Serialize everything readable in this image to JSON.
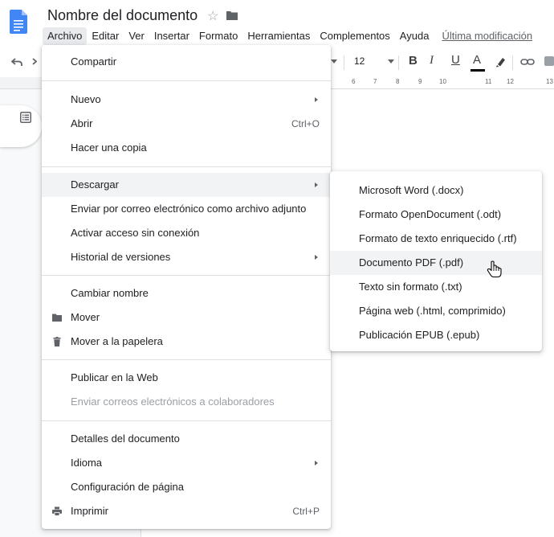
{
  "header": {
    "title": "Nombre del documento",
    "menus": [
      "Archivo",
      "Editar",
      "Ver",
      "Insertar",
      "Formato",
      "Herramientas",
      "Complementos",
      "Ayuda"
    ],
    "last_edit": "Última modificación"
  },
  "toolbar": {
    "font_size": "12",
    "bold": "B",
    "italic": "I",
    "underline": "U",
    "text_color": "A"
  },
  "ruler": [
    "6",
    "7",
    "8",
    "9",
    "10",
    "11",
    "12",
    "13"
  ],
  "file_menu": {
    "share": "Compartir",
    "new": "Nuevo",
    "open": "Abrir",
    "open_shortcut": "Ctrl+O",
    "copy": "Hacer una copia",
    "download": "Descargar",
    "email_attachment": "Enviar por correo electrónico como archivo adjunto",
    "offline": "Activar acceso sin conexión",
    "version_history": "Historial de versiones",
    "rename": "Cambiar nombre",
    "move": "Mover",
    "trash": "Mover a la papelera",
    "publish": "Publicar en la Web",
    "email_collaborators": "Enviar correos electrónicos a colaboradores",
    "details": "Detalles del documento",
    "language": "Idioma",
    "page_setup": "Configuración de página",
    "print": "Imprimir",
    "print_shortcut": "Ctrl+P"
  },
  "download_menu": {
    "items": [
      "Microsoft Word (.docx)",
      "Formato OpenDocument (.odt)",
      "Formato de texto enriquecido (.rtf)",
      "Documento PDF (.pdf)",
      "Texto sin formato (.txt)",
      "Página web (.html, comprimido)",
      "Publicación EPUB (.epub)"
    ],
    "hovered": "Documento PDF (.pdf)"
  },
  "colors": {
    "docs_blue": "#4285f4",
    "menu_highlight": "#f1f3f4",
    "disabled_text": "#9aa0a6"
  },
  "icons": {
    "logo": "docs-logo-icon",
    "star": "star-icon",
    "folder": "folder-icon",
    "undo": "undo-icon",
    "redo": "redo-icon",
    "highlight": "highlighter-icon",
    "link": "link-icon",
    "outline": "outline-icon",
    "move": "folder-icon",
    "trash": "trash-icon",
    "print": "printer-icon",
    "cursor": "hand-cursor-icon"
  }
}
